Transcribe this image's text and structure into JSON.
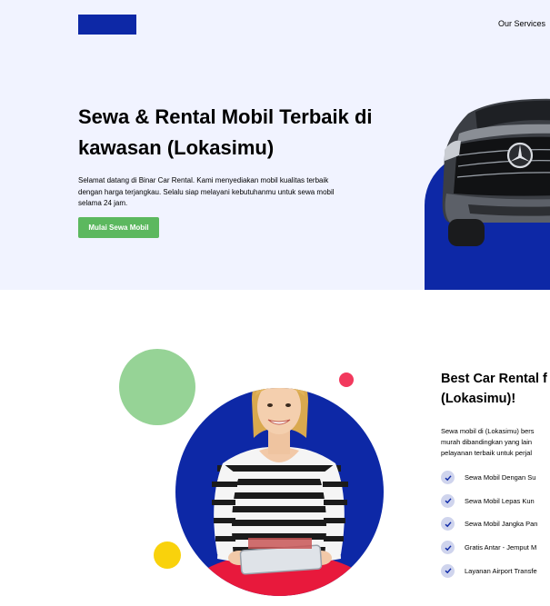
{
  "navbar": {
    "logo_text": "",
    "link_label": "Our Services"
  },
  "hero": {
    "title": "Sewa & Rental Mobil Terbaik di kawasan (Lokasimu)",
    "description": "Selamat datang di Binar Car Rental. Kami menyediakan mobil kualitas terbaik dengan harga terjangkau. Selalu siap melayani kebutuhanmu untuk sewa mobil selama 24 jam.",
    "cta_label": "Mulai Sewa Mobil"
  },
  "about": {
    "title_lines": [
      "Best Car Rental f",
      "(Lokasimu)!"
    ],
    "description_lines": [
      "Sewa mobil di (Lokasimu) bers",
      "murah dibandingkan yang lain",
      "pelayanan terbaik untuk perjal"
    ],
    "features": [
      "Sewa Mobil Dengan Su",
      "Sewa Mobil Lepas Kun",
      "Sewa Mobil Jangka Pan",
      "Gratis Antar - Jemput M",
      "Layanan Airport Transfe"
    ]
  },
  "colors": {
    "brand_blue": "#0d28a6",
    "hero_bg": "#f1f3ff",
    "cta_green": "#5cb85f",
    "accent_green": "#96d396",
    "accent_pink": "#f2395d",
    "accent_yellow": "#f9d20c",
    "check_bg": "#cfd4ed"
  }
}
